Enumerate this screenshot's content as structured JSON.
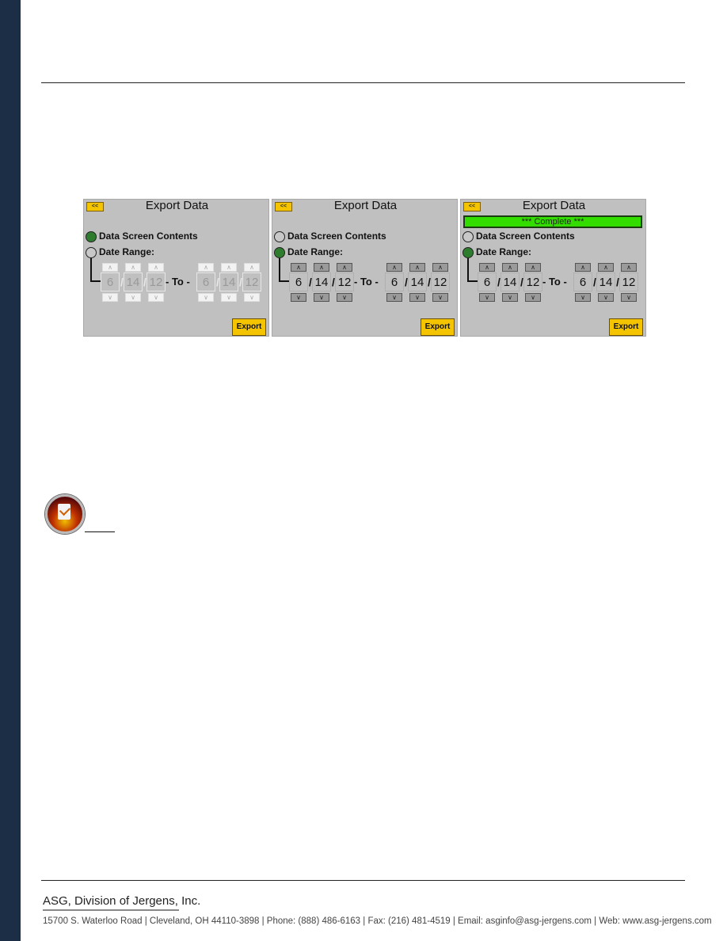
{
  "panels": [
    {
      "back_label": "<<",
      "title": "Export Data",
      "complete": null,
      "option1": "Data Screen Contents",
      "option2": "Date Range:",
      "selected": 1,
      "enabled": false,
      "from": [
        "6",
        "14",
        "12"
      ],
      "to_label": "- To -",
      "to": [
        "6",
        "14",
        "12"
      ],
      "export_label": "Export"
    },
    {
      "back_label": "<<",
      "title": "Export Data",
      "complete": null,
      "option1": "Data Screen Contents",
      "option2": "Date Range:",
      "selected": 2,
      "enabled": true,
      "from": [
        "6",
        "14",
        "12"
      ],
      "to_label": "- To -",
      "to": [
        "6",
        "14",
        "12"
      ],
      "export_label": "Export"
    },
    {
      "back_label": "<<",
      "title": "Export Data",
      "complete": "*** Complete ***",
      "option1": "Data Screen Contents",
      "option2": "Date Range:",
      "selected": 2,
      "enabled": true,
      "from": [
        "6",
        "14",
        "12"
      ],
      "to_label": "- To -",
      "to": [
        "6",
        "14",
        "12"
      ],
      "export_label": "Export"
    }
  ],
  "footer": {
    "company": "ASG, Division of Jergens, Inc.",
    "address": "15700 S. Waterloo Road | Cleveland, OH 44110-3898 | Phone: (888) 486-6163 | Fax: (216) 481-4519 | Email: asginfo@asg-jergens.com | Web: www.asg-jergens.com"
  },
  "colors": {
    "sidebar": "#1c2e45",
    "button": "#f4c400",
    "radio_on": "#2e7d2e",
    "complete": "#33dd00"
  },
  "note_icon": "clipboard-check-icon"
}
